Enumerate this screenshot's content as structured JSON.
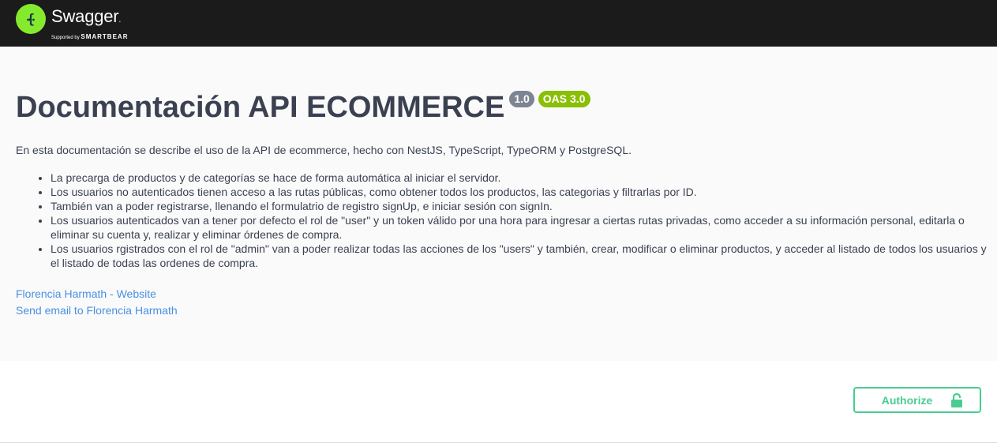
{
  "topbar": {
    "logo_title": "Swagger",
    "logo_dot": ".",
    "logo_sub_prefix": "Supported by ",
    "logo_sub_brand": "SMARTBEAR",
    "logo_icon": "swagger-logo-icon",
    "colors": {
      "background": "#1b1b1b",
      "logo": "#85ea2d"
    }
  },
  "info": {
    "title": "Documentación API ECOMMERCE",
    "version_badge": "1.0",
    "oas_badge": "OAS 3.0",
    "description_intro": "En esta documentación se describe el uso de la API de ecommerce, hecho con NestJS, TypeScript, TypeORM y PostgreSQL.",
    "bullets": [
      "La precarga de productos y de categorías se hace de forma automática al iniciar el servidor.",
      "Los usuarios no autenticados tienen acceso a las rutas públicas, como obtener todos los productos, las categorias y filtrarlas por ID.",
      "También van a poder registrarse, llenando el formulatrio de registro signUp, e iniciar sesión con signIn.",
      "Los usuarios autenticados van a tener por defecto el rol de \"user\" y un token válido por una hora para ingresar a ciertas rutas privadas, como acceder a su información personal, editarla o eliminar su cuenta y, realizar y eliminar órdenes de compra.",
      "Los usuarios rgistrados con el rol de \"admin\" van a poder realizar todas las acciones de los \"users\" y también, crear, modificar o eliminar productos, y acceder al listado de todos los usuarios y el listado de todas las ordenes de compra."
    ],
    "links": {
      "website": "Florencia Harmath - Website",
      "email": "Send email to Florencia Harmath"
    },
    "colors": {
      "title": "#3b4151",
      "version_badge": "#7d8492",
      "oas_badge": "#89bf04",
      "link": "#4990e2"
    }
  },
  "scheme": {
    "authorize_label": "Authorize",
    "authorize_icon": "unlocked-padlock-icon",
    "colors": {
      "authorize": "#49cc90"
    }
  }
}
